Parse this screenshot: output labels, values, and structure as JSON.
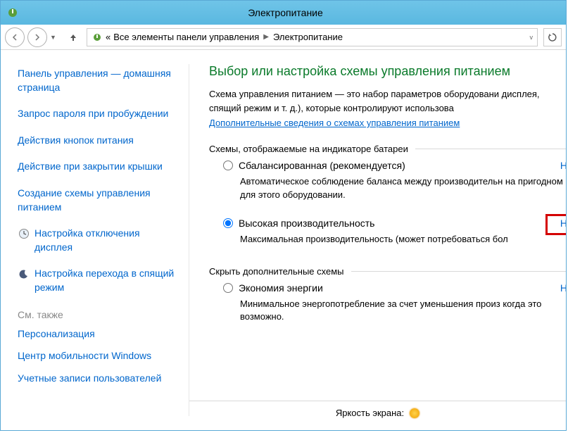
{
  "window": {
    "title": "Электропитание"
  },
  "breadcrumb": {
    "prefix": "«",
    "part1": "Все элементы панели управления",
    "part2": "Электропитание"
  },
  "sidebar": {
    "home": "Панель управления — домашняя страница",
    "links": [
      "Запрос пароля при пробуждении",
      "Действия кнопок питания",
      "Действие при закрытии крышки",
      "Создание схемы управления питанием"
    ],
    "icon_links": [
      {
        "icon": "clock-icon",
        "label": "Настройка отключения дисплея"
      },
      {
        "icon": "moon-icon",
        "label": "Настройка перехода в спящий режим"
      }
    ],
    "see_also_heading": "См. также",
    "see_also": [
      "Персонализация",
      "Центр мобильности Windows",
      "Учетные записи пользователей"
    ]
  },
  "main": {
    "title": "Выбор или настройка схемы управления питанием",
    "description": "Схема управления питанием — это набор параметров оборудовани дисплея, спящий режим и т. д.), которые контролируют использова",
    "more_link": "Дополнительные сведения о схемах управления питанием",
    "group_visible": "Схемы, отображаемые на индикаторе батареи",
    "group_hidden": "Скрыть дополнительные схемы",
    "plans": [
      {
        "label": "Сбалансированная (рекомендуется)",
        "desc": "Автоматическое соблюдение баланса между производительн на пригодном для этого оборудовании.",
        "checked": false,
        "config": "Н"
      },
      {
        "label": "Высокая производительность",
        "desc": "Максимальная производительность (может потребоваться бол",
        "checked": true,
        "config": "Н",
        "highlight": true
      }
    ],
    "hidden_plans": [
      {
        "label": "Экономия энергии",
        "desc": "Минимальное энергопотребление за счет уменьшения произ когда это возможно.",
        "checked": false,
        "config": "Н"
      }
    ],
    "brightness_label": "Яркость экрана:"
  }
}
